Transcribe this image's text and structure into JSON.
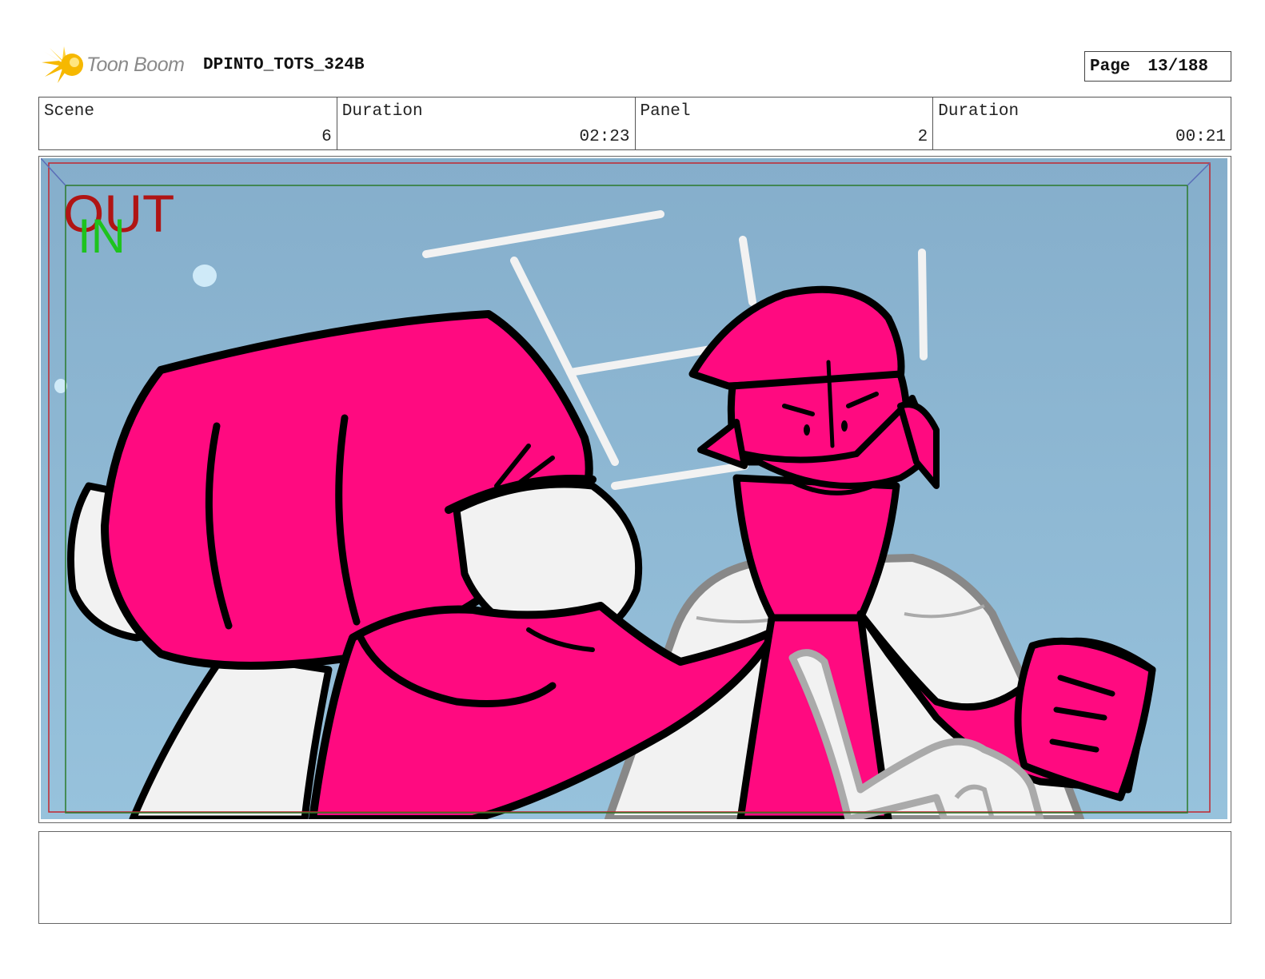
{
  "header": {
    "logo_text": "Toon Boom",
    "project_title": "DPINTO_TOTS_324B",
    "page_label": "Page",
    "page_number": "13/188"
  },
  "info": {
    "scene_label": "Scene",
    "scene_value": "6",
    "scene_duration_label": "Duration",
    "scene_duration_value": "02:23",
    "panel_label": "Panel",
    "panel_value": "2",
    "panel_duration_label": "Duration",
    "panel_duration_value": "00:21"
  },
  "panel_overlay": {
    "out_text": "OUT",
    "in_text": "IN"
  },
  "colors": {
    "sky": "#8db6d1",
    "character_pink": "#ff0a80",
    "outline": "#000000",
    "white_fill": "#f2f2f2",
    "out_red": "#b01414",
    "in_green": "#1ec31e",
    "logo_yellow": "#f6b800"
  },
  "caption": {
    "action_notes": ""
  }
}
